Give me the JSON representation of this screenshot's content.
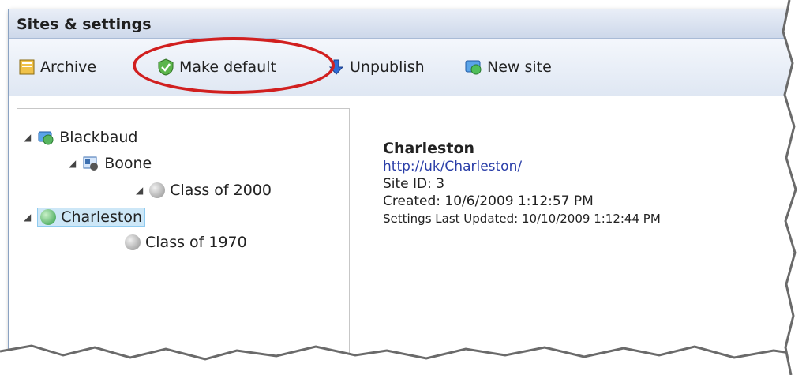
{
  "window": {
    "title": "Sites & settings"
  },
  "toolbar": {
    "archive": "Archive",
    "make_default": "Make default",
    "unpublish": "Unpublish",
    "new_site": "New site"
  },
  "tree": {
    "root": "Blackbaud",
    "boone": "Boone",
    "class_2000": "Class of 2000",
    "charleston": "Charleston",
    "class_1970": "Class of 1970"
  },
  "details": {
    "name": "Charleston",
    "url": "http://uk/Charleston/",
    "site_id": "Site ID: 3",
    "created": "Created: 10/6/2009 1:12:57 PM",
    "settings_updated": "Settings Last Updated: 10/10/2009 1:12:44 PM"
  },
  "colors": {
    "highlight": "#d11f1f",
    "link": "#2a3ea8",
    "selected_bg": "#cde7f7"
  }
}
